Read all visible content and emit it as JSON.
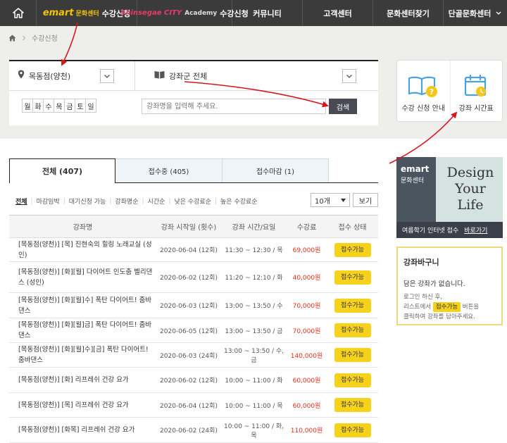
{
  "nav": {
    "items": [
      {
        "label": "수강신청",
        "brand": "emart",
        "brand_sub": "문화센터"
      },
      {
        "label": "수강신청",
        "brand": "Shinsegae",
        "brand_city": "CITY",
        "brand_sub": "Academy"
      },
      {
        "label": "커뮤니티"
      },
      {
        "label": "고객센터"
      },
      {
        "label": "문화센터찾기"
      },
      {
        "label": "단골문화센터"
      }
    ]
  },
  "breadcrumb": {
    "current": "수강신청"
  },
  "search": {
    "branch": "목동점(양천)",
    "category": "강좌군 전체",
    "days": [
      "월",
      "화",
      "수",
      "목",
      "금",
      "토",
      "일"
    ],
    "keyword_placeholder": "강좌명을 입력해 주세요.",
    "search_label": "검색"
  },
  "guide": {
    "apply_guide": "수강 신청 안내",
    "timetable": "강좌 시간표"
  },
  "tabs": [
    {
      "label": "전체 (407)",
      "active": true
    },
    {
      "label": "접수중 (405)"
    },
    {
      "label": "접수마감 (1)"
    }
  ],
  "sort": {
    "options": [
      "전체",
      "마감임박",
      "대기신청 가능",
      "강좌명순",
      "시간순",
      "낮은 수강료순",
      "높은 수강료순"
    ],
    "count": "10개",
    "view_label": "보기"
  },
  "table": {
    "headers": [
      "강좌명",
      "강좌 시작일 (횟수)",
      "강좌 시간/요일",
      "수강료",
      "접수 상태"
    ],
    "rows": [
      {
        "name": "[목동점(양천)] [목] 진현숙의 힐링 노래교실 (성인)",
        "start": "2020-06-04 (12회)",
        "time": "11:30 ~ 12:30 / 목",
        "fee": "69,000원",
        "status": "접수가능"
      },
      {
        "name": "[목동점(양천)] [화][월] 다이어트 인도춤 벨리댄스 (성인)",
        "start": "2020-06-02 (12회)",
        "time": "11:20 ~ 12:10 / 화",
        "fee": "40,000원",
        "status": "접수가능"
      },
      {
        "name": "[목동점(양천)] [화][월]수] 폭탄 다이어트! 줌바댄스",
        "start": "2020-06-03 (12회)",
        "time": "13:00 ~ 13:50 / 수",
        "fee": "70,000원",
        "status": "접수가능"
      },
      {
        "name": "[목동점(양천)] [화][월]금] 폭탄 다이어트! 줌바댄스",
        "start": "2020-06-05 (12회)",
        "time": "13:00 ~ 13:50 / 금",
        "fee": "70,000원",
        "status": "접수가능"
      },
      {
        "name": "[목동점(양천)] [화][월]수][금] 폭탄 다이어트! 줌바댄스",
        "start": "2020-06-03 (24회)",
        "time": "13:00 ~ 13:50 / 수, 금",
        "fee": "140,000원",
        "status": "접수가능"
      },
      {
        "name": "[목동점(양천)] [화] 리프레쉬 건강 요가",
        "start": "2020-06-02 (12회)",
        "time": "10:00 ~ 11:00 / 화",
        "fee": "60,000원",
        "status": "접수가능"
      },
      {
        "name": "[목동점(양천)] [목] 리프레쉬 건강 요가",
        "start": "2020-06-04 (12회)",
        "time": "10:00 ~ 11:00 / 목",
        "fee": "60,000원",
        "status": "접수가능"
      },
      {
        "name": "[목동점(양천)] [화목] 리프레쉬 건강 요가",
        "start": "2020-06-02 (24회)",
        "time": "10:00 ~ 11:00 / 화, 목",
        "fee": "110,000원",
        "status": "접수가능"
      }
    ]
  },
  "banner": {
    "brand": "emart",
    "brand_sub": "문화센터",
    "headline": [
      "Design",
      "Your",
      "Life"
    ],
    "footer_text": "여름학기 인터넷 접수",
    "footer_link": "바로가기"
  },
  "basket": {
    "title": "강좌바구니",
    "empty": "담은 강좌가 없습니다.",
    "desc_1": "로그인 하신 후,",
    "desc_2": "리스트에서",
    "chip": "접수가능",
    "desc_3": "버튼을",
    "desc_4": "클릭하여 강좌를 담아주세요."
  },
  "colors": {
    "nav_bg": "#3b3b3b",
    "accent_yellow": "#f7d21b",
    "price_red": "#e0301e",
    "annotation_red": "#d8141e"
  }
}
